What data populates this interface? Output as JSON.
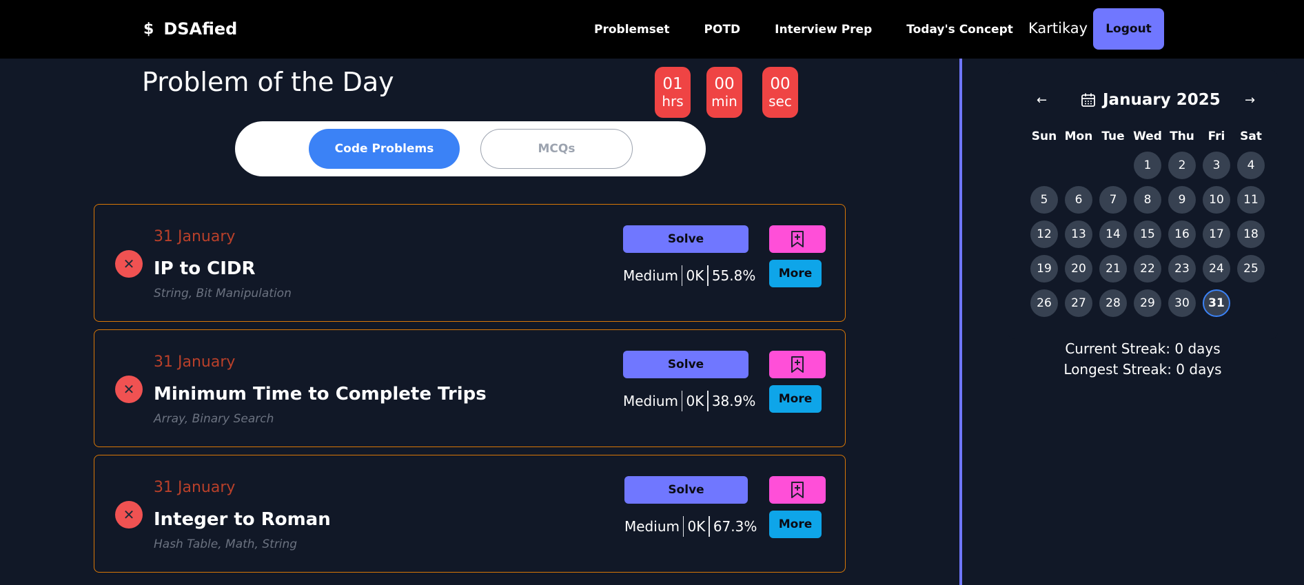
{
  "navbar": {
    "brand_icon": "$",
    "brand": "DSAfied",
    "links": [
      "Problemset",
      "POTD",
      "Interview Prep",
      "Today's Concept"
    ],
    "user": "Kartikay",
    "logout_label": "Logout"
  },
  "page": {
    "title": "Problem of the Day"
  },
  "timer": {
    "hours": "01",
    "hours_label": "hrs",
    "minutes": "00",
    "minutes_label": "min",
    "seconds": "00",
    "seconds_label": "sec"
  },
  "tabs": {
    "code": "Code Problems",
    "mcq": "MCQs"
  },
  "problems": [
    {
      "date": "31 January",
      "title": "IP to CIDR",
      "tags": "String, Bit Manipulation",
      "solve_label": "Solve",
      "difficulty": "Medium",
      "count": "0K",
      "acceptance": "55.8%",
      "more_label": "More"
    },
    {
      "date": "31 January",
      "title": "Minimum Time to Complete Trips",
      "tags": "Array, Binary Search",
      "solve_label": "Solve",
      "difficulty": "Medium",
      "count": "0K",
      "acceptance": "38.9%",
      "more_label": "More"
    },
    {
      "date": "31 January",
      "title": "Integer to Roman",
      "tags": "Hash Table, Math, String",
      "solve_label": "Solve",
      "difficulty": "Medium",
      "count": "0K",
      "acceptance": "67.3%",
      "more_label": "More"
    }
  ],
  "calendar": {
    "prev": "←",
    "next": "→",
    "month": "January 2025",
    "weekdays": [
      "Sun",
      "Mon",
      "Tue",
      "Wed",
      "Thu",
      "Fri",
      "Sat"
    ],
    "first_weekday": 3,
    "days_in_month": 31,
    "selected_day": 31
  },
  "streak": {
    "current": "Current Streak: 0 days",
    "longest": "Longest Streak: 0 days"
  },
  "colors": {
    "background": "#111827",
    "accent": "#7077ff",
    "timer": "#ef4444",
    "bookmark": "#ff4fd8",
    "more": "#0ea5e9",
    "card_border": "#d97706"
  },
  "icons": {
    "status": "close-icon",
    "bookmark": "bookmark-plus-icon",
    "calendar": "calendar-icon"
  }
}
